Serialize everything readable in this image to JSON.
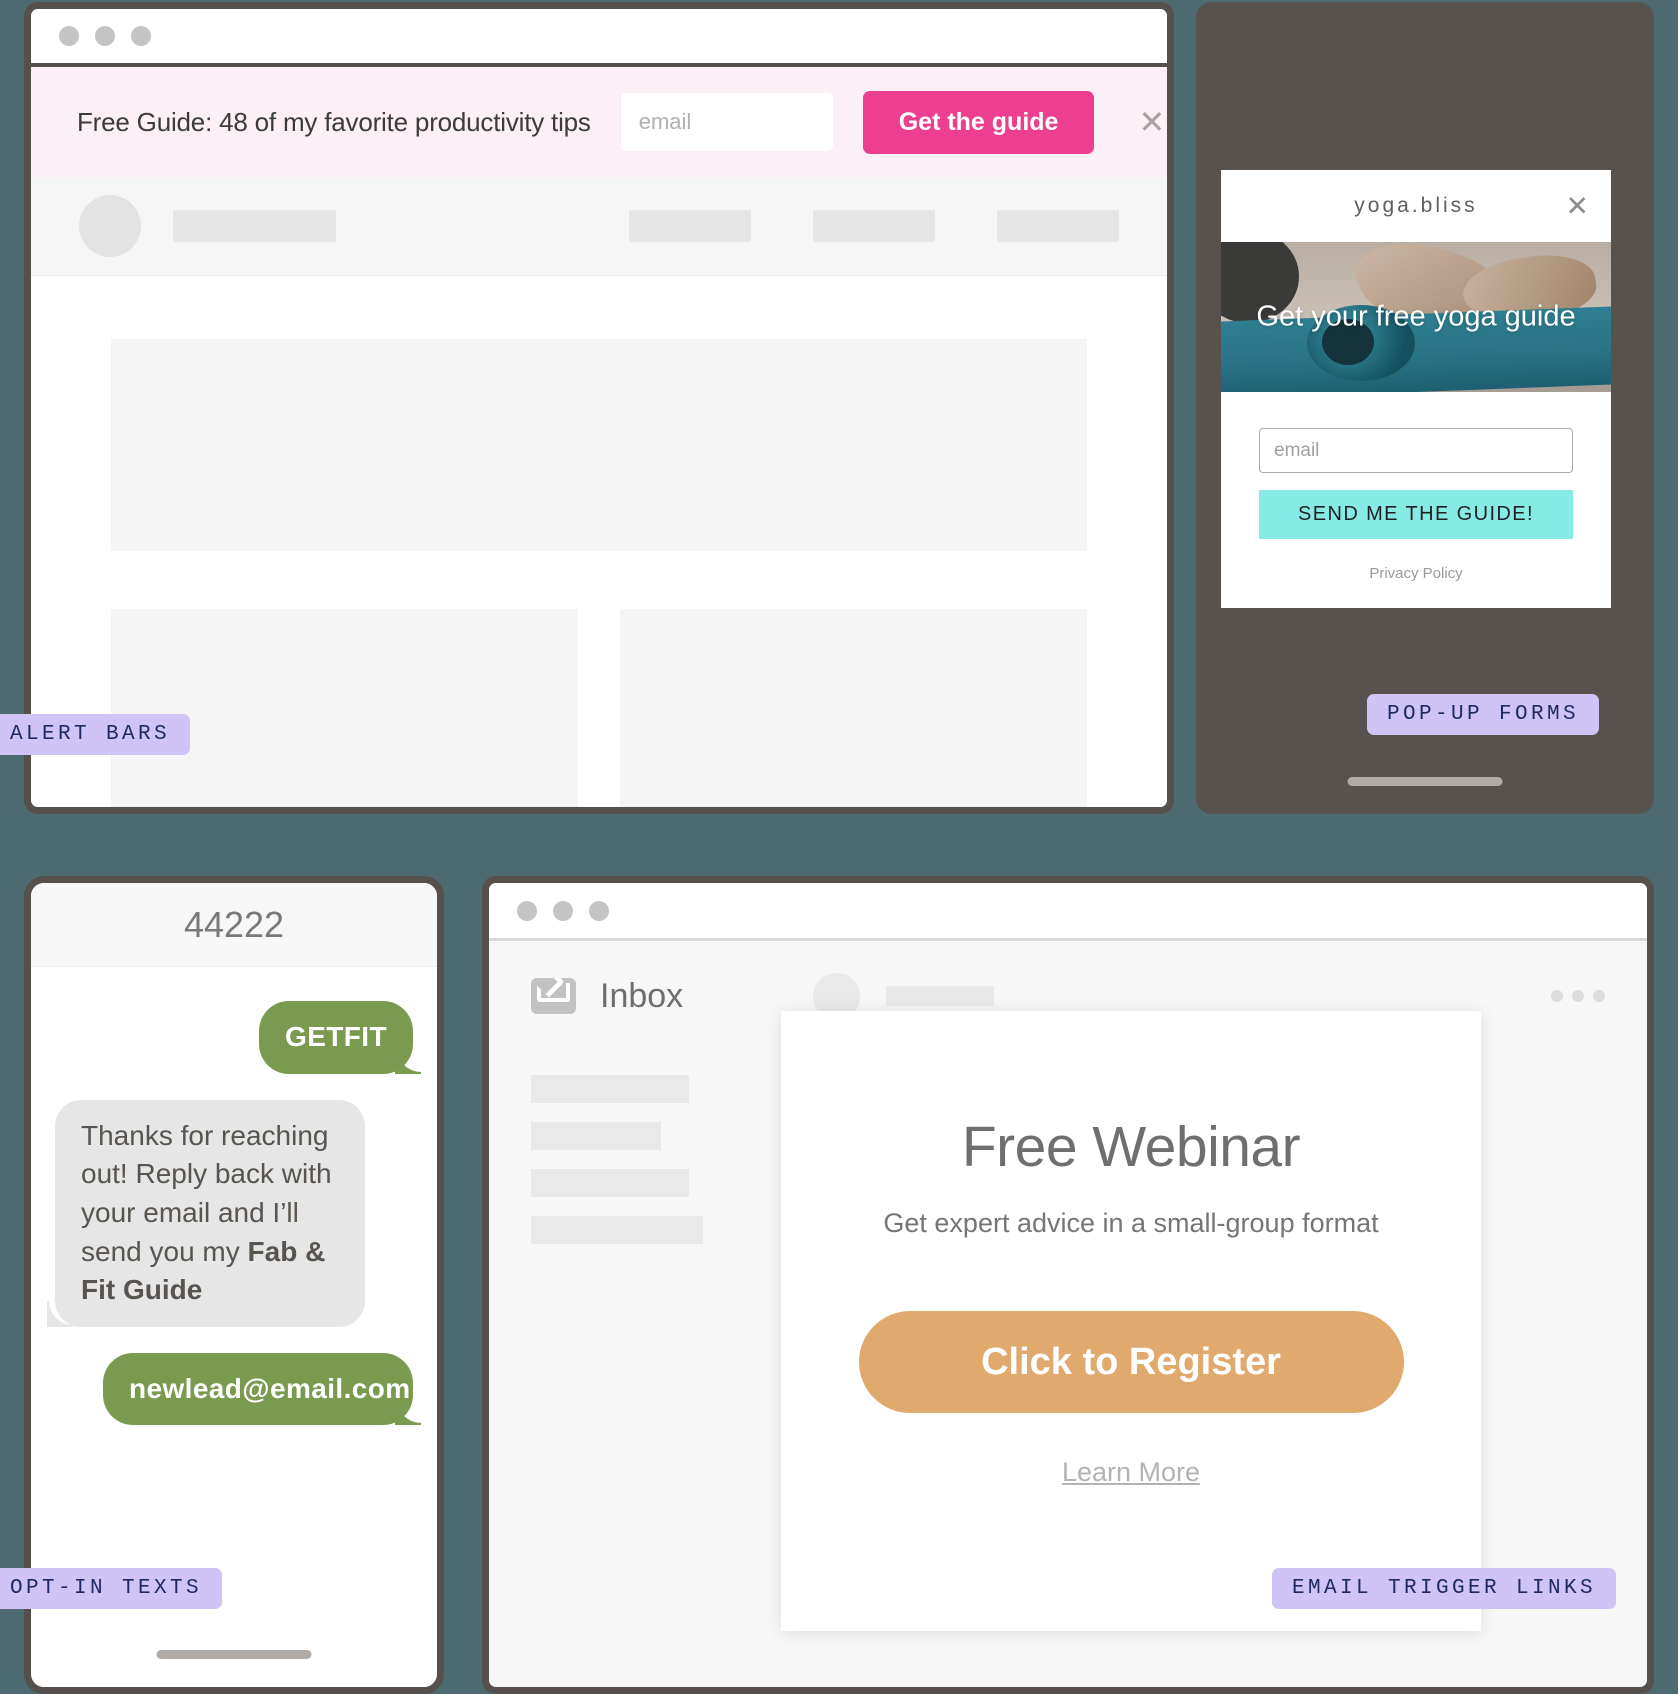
{
  "tags": {
    "alert_bars": "ALERT BARS",
    "popup_forms": "POP-UP FORMS",
    "optin_texts": "OPT-IN TEXTS",
    "email_trigger_links": "EMAIL TRIGGER LINKS"
  },
  "alert_bar": {
    "message": "Free Guide: 48 of my favorite productivity tips",
    "email_placeholder": "email",
    "email_value": "",
    "button_label": "Get the guide",
    "close_icon": "close-icon",
    "bg_color": "#fceff5",
    "button_color": "#ec3f8f"
  },
  "popup": {
    "brand": "yoga.bliss",
    "close_icon": "close-icon",
    "headline": "Get your free yoga guide",
    "email_placeholder": "email",
    "email_value": "",
    "button_label": "SEND ME THE GUIDE!",
    "privacy_label": "Privacy Policy",
    "button_color": "#86ebe4"
  },
  "sms": {
    "shortcode": "44222",
    "messages": [
      {
        "side": "right",
        "style": "green",
        "text": "GETFIT"
      },
      {
        "side": "left",
        "style": "grey",
        "text_plain": "Thanks for reaching out! Reply back with your email and I’ll send you my ",
        "text_bold": "Fab & Fit Guide"
      },
      {
        "side": "right",
        "style": "green",
        "text": "newlead@email.com"
      }
    ],
    "bubble_green": "#7a9b4f",
    "bubble_grey": "#e6e6e6"
  },
  "mail": {
    "inbox_label": "Inbox",
    "envelope_icon": "envelope-icon",
    "overflow_icon": "more-horizontal-icon"
  },
  "webinar": {
    "title": "Free Webinar",
    "subtitle": "Get expert advice in a small-group format",
    "cta_label": "Click to Register",
    "link_label": "Learn More",
    "cta_color": "#e0a96d"
  }
}
